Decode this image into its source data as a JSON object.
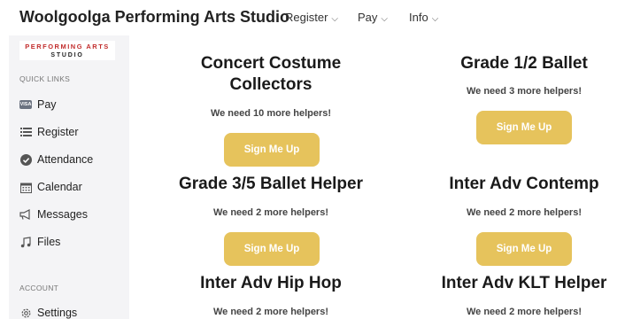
{
  "header": {
    "brand": "Woolgoolga Performing Arts Studio",
    "nav": [
      {
        "label": "Register",
        "chevron": "⌵"
      },
      {
        "label": "Pay",
        "chevron": "⌵"
      },
      {
        "label": "Info",
        "chevron": "⌵"
      }
    ]
  },
  "sidebar": {
    "logo": {
      "line1": "PERFORMING ARTS",
      "line2": "STUDIO"
    },
    "quick_links_label": "QUICK LINKS",
    "items": [
      {
        "label": "Pay",
        "icon": "visa-card-icon",
        "badge": "VISA"
      },
      {
        "label": "Register",
        "icon": "list-icon"
      },
      {
        "label": "Attendance",
        "icon": "check-circle-icon"
      },
      {
        "label": "Calendar",
        "icon": "calendar-icon"
      },
      {
        "label": "Messages",
        "icon": "megaphone-icon"
      },
      {
        "label": "Files",
        "icon": "music-note-icon"
      }
    ],
    "account_label": "ACCOUNT",
    "account_items": [
      {
        "label": "Settings",
        "icon": "gear-icon"
      }
    ]
  },
  "cards": [
    {
      "title_line1": "Concert Costume",
      "title_line2": "Collectors",
      "need": "We need 10 more helpers!",
      "button": "Sign Me Up"
    },
    {
      "title_line1": "Grade 1/2 Ballet",
      "need": "We need 3 more helpers!",
      "button": "Sign Me Up"
    },
    {
      "title_line1": "Grade 3/5 Ballet Helper",
      "need": "We need 2 more helpers!",
      "button": "Sign Me Up"
    },
    {
      "title_line1": "Inter Adv Contemp",
      "need": "We need 2 more helpers!",
      "button": "Sign Me Up"
    },
    {
      "title_line1": "Inter Adv Hip Hop",
      "need": "We need 2 more helpers!"
    },
    {
      "title_line1": "Inter Adv KLT Helper",
      "need": "We need 2 more helpers!"
    }
  ],
  "colors": {
    "button": "#e6c35c",
    "logo_red": "#c22d2d",
    "sidebar_bg": "#f4f4f6"
  }
}
